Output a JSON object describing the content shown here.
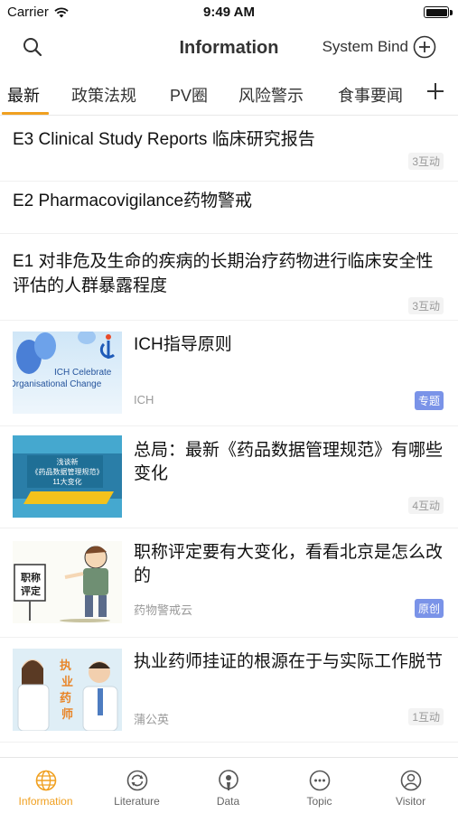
{
  "status_bar": {
    "carrier": "Carrier",
    "time": "9:49 AM"
  },
  "nav": {
    "title": "Information",
    "bind_label": "System Bind"
  },
  "tabs": [
    {
      "label": "最新"
    },
    {
      "label": "政策法规"
    },
    {
      "label": "PV圈"
    },
    {
      "label": "风险警示"
    },
    {
      "label": "食事要闻"
    }
  ],
  "text_articles": [
    {
      "title": "E3 Clinical Study Reports 临床研究报告",
      "count": "3互动"
    },
    {
      "title": "E2 Pharmacovigilance药物警戒",
      "count": ""
    },
    {
      "title": "E1 对非危及生命的疾病的长期治疗药物进行临床安全性评估的人群暴露程度",
      "count": "3互动"
    }
  ],
  "image_articles": [
    {
      "title": "ICH指导原则",
      "source": "ICH",
      "tag": "专题",
      "count": "",
      "thumb_text_1": "ICH Celebrate",
      "thumb_text_2": "Organisational Change"
    },
    {
      "title": "总局：最新《药品数据管理规范》有哪些变化",
      "source": "",
      "tag": "",
      "count": "4互动",
      "thumb_text_1": "浅谈新",
      "thumb_text_2": "《药品数据管理规范》",
      "thumb_text_3": "11大变化"
    },
    {
      "title": "职称评定要有大变化，看看北京是怎么改的",
      "source": "药物警戒云",
      "tag": "原创",
      "count": "",
      "thumb_text_1": "职称",
      "thumb_text_2": "评定"
    },
    {
      "title": "执业药师挂证的根源在于与实际工作脱节",
      "source": "蒲公英",
      "tag": "",
      "count": "1互动",
      "thumb_text_1": "执",
      "thumb_text_2": "业",
      "thumb_text_3": "药",
      "thumb_text_4": "师"
    }
  ],
  "bottom_tabs": [
    {
      "label": "Information",
      "icon": "globe-icon"
    },
    {
      "label": "Literature",
      "icon": "refresh-icon"
    },
    {
      "label": "Data",
      "icon": "podcast-icon"
    },
    {
      "label": "Topic",
      "icon": "chat-bubble-icon"
    },
    {
      "label": "Visitor",
      "icon": "user-icon"
    }
  ],
  "colors": {
    "accent": "#f0a020",
    "tag": "#7a93e8"
  }
}
